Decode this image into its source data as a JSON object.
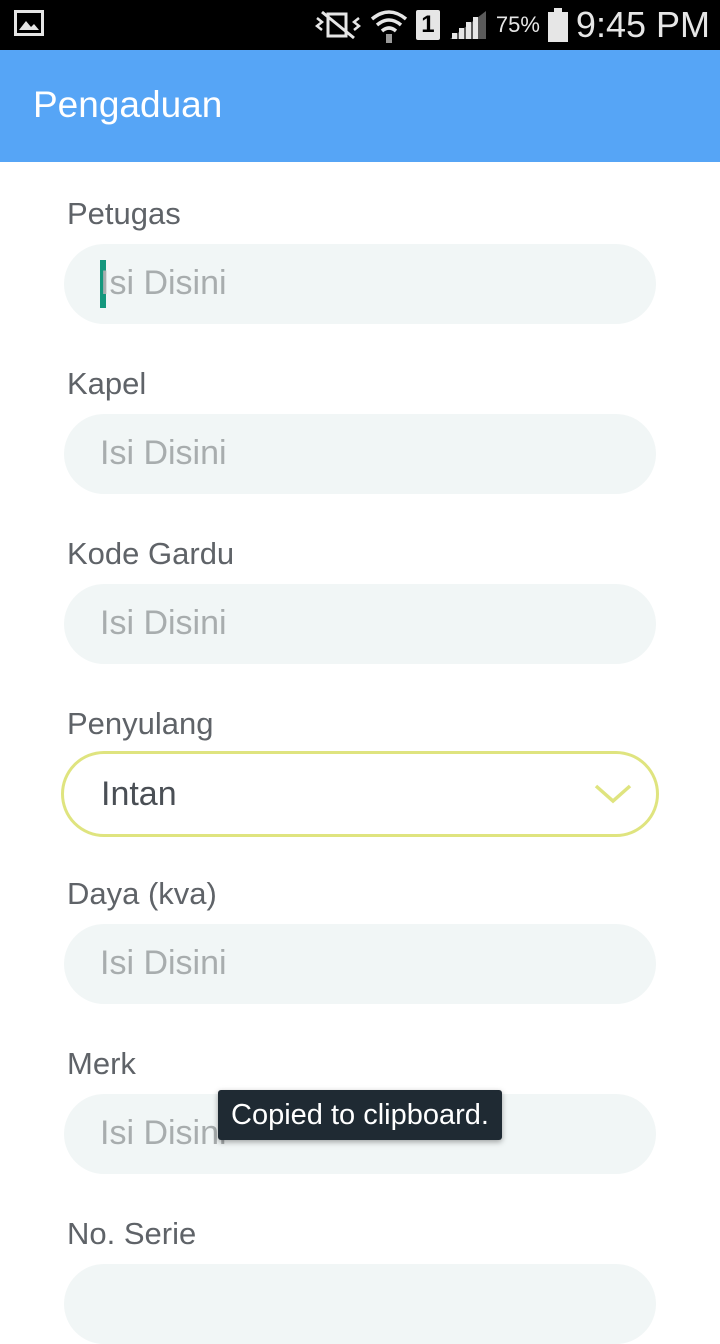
{
  "status_bar": {
    "battery_percent": "75%",
    "time": "9:45 PM",
    "sim_slot": "1",
    "icons": [
      "gallery-icon",
      "mute-vibrate-icon",
      "wifi-icon",
      "sim-icon",
      "signal-icon",
      "battery-icon"
    ]
  },
  "appbar": {
    "title": "Pengaduan",
    "color": "#56a5f6"
  },
  "form": {
    "fields": [
      {
        "label": "Petugas",
        "placeholder": "Isi Disini",
        "focused": true
      },
      {
        "label": "Kapel",
        "placeholder": "Isi Disini"
      },
      {
        "label": "Kode Gardu",
        "placeholder": "Isi Disini"
      },
      {
        "label": "Penyulang",
        "type": "select",
        "value": "Intan"
      },
      {
        "label": "Daya (kva)",
        "placeholder": "Isi Disini"
      },
      {
        "label": "Merk",
        "placeholder": "Isi Disini"
      },
      {
        "label": "No. Serie",
        "placeholder": ""
      }
    ]
  },
  "toast": {
    "text": "Copied to clipboard."
  },
  "colors": {
    "input_bg": "#f1f6f6",
    "select_border": "#dfe47f",
    "cursor": "#14977d"
  }
}
